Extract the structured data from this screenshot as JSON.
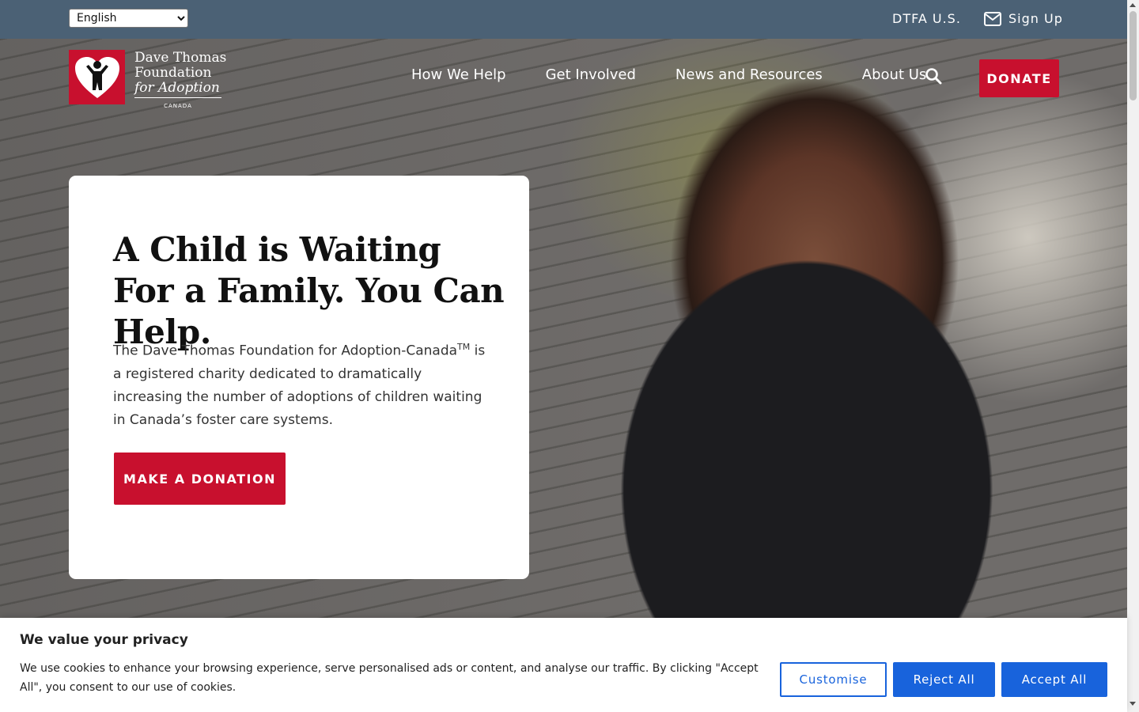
{
  "topbar": {
    "language_selected": "English",
    "dtfa_link": "DTFA U.S.",
    "signup_link": "Sign Up"
  },
  "header": {
    "logo": {
      "line1": "Dave Thomas",
      "line2": "Foundation",
      "line3": "for Adoption",
      "line4": "CANADA"
    },
    "nav": [
      {
        "label": "How We Help"
      },
      {
        "label": "Get Involved"
      },
      {
        "label": "News and Resources"
      },
      {
        "label": "About Us"
      }
    ],
    "donate_label": "DONATE"
  },
  "hero": {
    "title": "A Child is Waiting For a Family. You Can Help.",
    "body_pre": "The Dave Thomas Foundation for Adoption-Canada",
    "body_tm": "TM",
    "body_post": " is a registered charity dedicated to dramatically increasing the number of adoptions of children waiting in Canada’s foster care systems.",
    "cta_label": "MAKE A DONATION"
  },
  "cookie_banner": {
    "title": "We value your privacy",
    "text": "We use cookies to enhance your browsing experience, serve personalised ads or content, and analyse our traffic. By clicking \"Accept All\", you consent to our use of cookies.",
    "customise_label": "Customise",
    "reject_label": "Reject All",
    "accept_label": "Accept All"
  },
  "colors": {
    "topbar": "#4b6175",
    "brand_red": "#c8102e",
    "cookie_blue": "#1863dc"
  },
  "icons": [
    "mail-icon",
    "search-icon",
    "logo-heart-child-icon"
  ]
}
